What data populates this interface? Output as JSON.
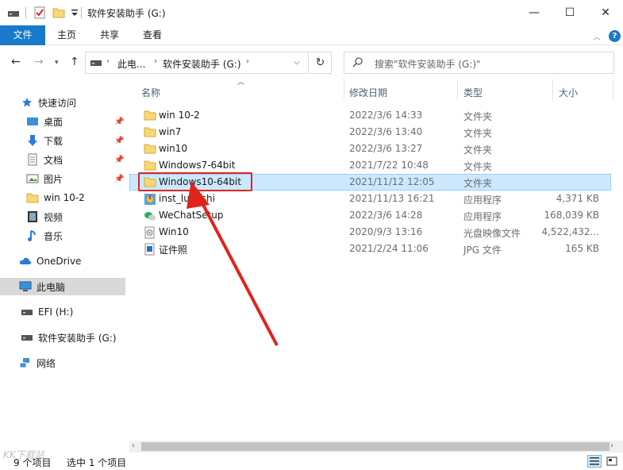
{
  "window": {
    "title": "软件安装助手 (G:)",
    "controls": {
      "minimize": "—",
      "maximize": "☐",
      "close": "✕"
    }
  },
  "ribbon": {
    "tabs": [
      "文件",
      "主页",
      "共享",
      "查看"
    ],
    "help": "?"
  },
  "address": {
    "segments": [
      "此电...",
      "软件安装助手 (G:)"
    ],
    "search_placeholder": "搜索\"软件安装助手 (G:)\""
  },
  "nav_pane": {
    "quick_access": "快速访问",
    "items": [
      {
        "label": "桌面",
        "icon": "desktop-icon",
        "pinned": true
      },
      {
        "label": "下载",
        "icon": "download-icon",
        "pinned": true
      },
      {
        "label": "文档",
        "icon": "documents-icon",
        "pinned": true
      },
      {
        "label": "图片",
        "icon": "pictures-icon",
        "pinned": true
      },
      {
        "label": "win 10-2",
        "icon": "folder-icon",
        "pinned": false
      },
      {
        "label": "视频",
        "icon": "videos-icon",
        "pinned": false
      },
      {
        "label": "音乐",
        "icon": "music-icon",
        "pinned": false
      }
    ],
    "onedrive": "OneDrive",
    "this_pc": "此电脑",
    "drives": [
      "EFI (H:)",
      "软件安装助手 (G:)"
    ],
    "network": "网络"
  },
  "columns": {
    "name": "名称",
    "date": "修改日期",
    "type": "类型",
    "size": "大小"
  },
  "files": [
    {
      "name": "win 10-2",
      "date": "2022/3/6 14:33",
      "type": "文件夹",
      "size": "",
      "icon": "folder-icon"
    },
    {
      "name": "win7",
      "date": "2022/3/6 13:40",
      "type": "文件夹",
      "size": "",
      "icon": "folder-icon"
    },
    {
      "name": "win10",
      "date": "2022/3/6 13:27",
      "type": "文件夹",
      "size": "",
      "icon": "folder-icon"
    },
    {
      "name": "Windows7-64bit",
      "date": "2021/7/22 10:48",
      "type": "文件夹",
      "size": "",
      "icon": "folder-icon"
    },
    {
      "name": "Windows10-64bit",
      "date": "2021/11/12 12:05",
      "type": "文件夹",
      "size": "",
      "icon": "folder-icon",
      "selected": true
    },
    {
      "name": "inst_ludashi",
      "date": "2021/11/13 16:21",
      "type": "应用程序",
      "size": "4,371 KB",
      "icon": "ludashi-app-icon"
    },
    {
      "name": "WeChatSetup",
      "date": "2022/3/6 14:28",
      "type": "应用程序",
      "size": "168,039 KB",
      "icon": "wechat-icon"
    },
    {
      "name": "Win10",
      "date": "2020/9/3 13:16",
      "type": "光盘映像文件",
      "size": "4,522,432...",
      "icon": "disc-image-icon"
    },
    {
      "name": "证件照",
      "date": "2021/2/24 11:06",
      "type": "JPG 文件",
      "size": "165 KB",
      "icon": "jpg-icon"
    }
  ],
  "status": {
    "count": "9 个项目",
    "selected": "选中 1 个项目"
  },
  "watermark": "KK下载站",
  "colors": {
    "accent": "#1979ca",
    "selection": "#cce8ff",
    "annotation": "#e0241c"
  }
}
